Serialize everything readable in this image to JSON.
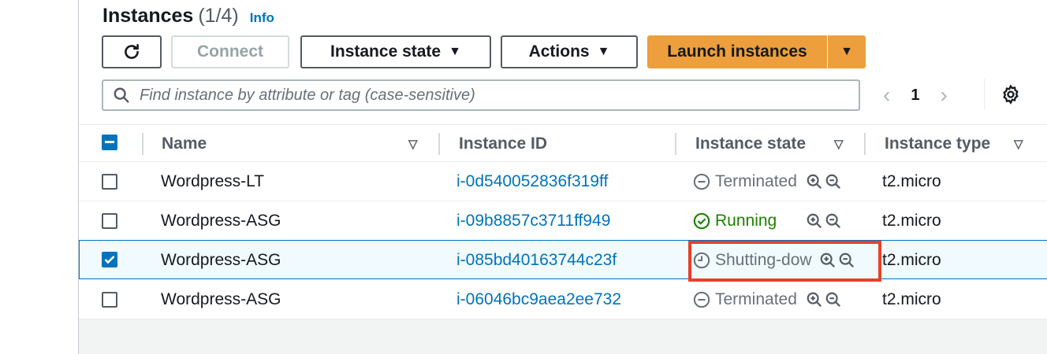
{
  "header": {
    "title": "Instances",
    "count": "(1/4)",
    "info": "Info"
  },
  "toolbar": {
    "connect": "Connect",
    "instance_state": "Instance state",
    "actions": "Actions",
    "launch": "Launch instances"
  },
  "search": {
    "placeholder": "Find instance by attribute or tag (case-sensitive)"
  },
  "pagination": {
    "current_page": "1"
  },
  "columns": {
    "name": "Name",
    "instance_id": "Instance ID",
    "instance_state": "Instance state",
    "instance_type": "Instance type"
  },
  "rows": [
    {
      "name": "Wordpress-LT",
      "id": "i-0d540052836f319ff",
      "state": "Terminated",
      "type": "t2.micro",
      "selected": false
    },
    {
      "name": "Wordpress-ASG",
      "id": "i-09b8857c3711ff949",
      "state": "Running",
      "type": "t2.micro",
      "selected": false
    },
    {
      "name": "Wordpress-ASG",
      "id": "i-085bd40163744c23f",
      "state": "Shutting-dow",
      "type": "t2.micro",
      "selected": true
    },
    {
      "name": "Wordpress-ASG",
      "id": "i-06046bc9aea2ee732",
      "state": "Terminated",
      "type": "t2.micro",
      "selected": false
    }
  ],
  "colors": {
    "link": "#0073bb",
    "accent": "#ec9f3c",
    "running": "#1d8102",
    "highlight": "#e8402a"
  }
}
